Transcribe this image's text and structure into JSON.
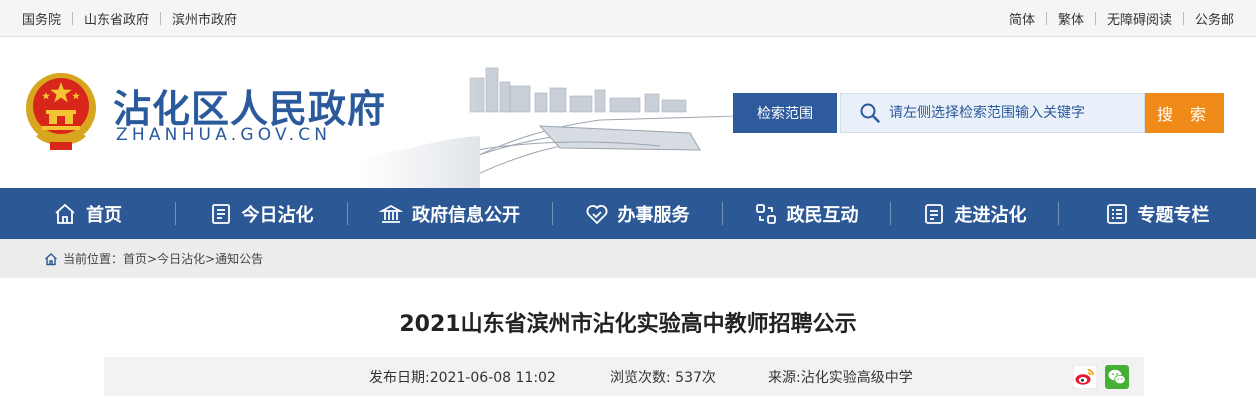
{
  "topbar": {
    "left_links": [
      "国务院",
      "山东省政府",
      "滨州市政府"
    ],
    "right_links": [
      "简体",
      "繁体",
      "无障碍阅读",
      "公务邮"
    ]
  },
  "header": {
    "title": "沾化区人民政府",
    "domain": "ZHANHUA.GOV.CN"
  },
  "search": {
    "scope_label": "检索范围",
    "placeholder": "请左侧选择检索范围输入关键字",
    "button_label": "搜 索"
  },
  "nav": {
    "items": [
      {
        "label": "首页",
        "icon": "home-icon"
      },
      {
        "label": "今日沾化",
        "icon": "news-icon"
      },
      {
        "label": "政府信息公开",
        "icon": "government-building-icon"
      },
      {
        "label": "办事服务",
        "icon": "handshake-icon"
      },
      {
        "label": "政民互动",
        "icon": "interaction-icon"
      },
      {
        "label": "走进沾化",
        "icon": "document-icon"
      },
      {
        "label": "专题专栏",
        "icon": "list-icon"
      }
    ]
  },
  "breadcrumb": {
    "prefix": "当前位置：",
    "items": [
      "首页",
      "今日沾化",
      "通知公告"
    ],
    "separator": ">"
  },
  "article": {
    "title": "2021山东省滨州市沾化实验高中教师招聘公示",
    "publish_date": "发布日期:2021-06-08 11:02",
    "views": "浏览次数: 537次",
    "source": "来源:沾化实验高级中学"
  },
  "share": {
    "icons": [
      "weibo-icon",
      "wechat-icon"
    ]
  },
  "colors": {
    "brand_blue": "#2c5896",
    "accent_orange": "#f08b1a",
    "search_bg": "#eaf0f9"
  }
}
